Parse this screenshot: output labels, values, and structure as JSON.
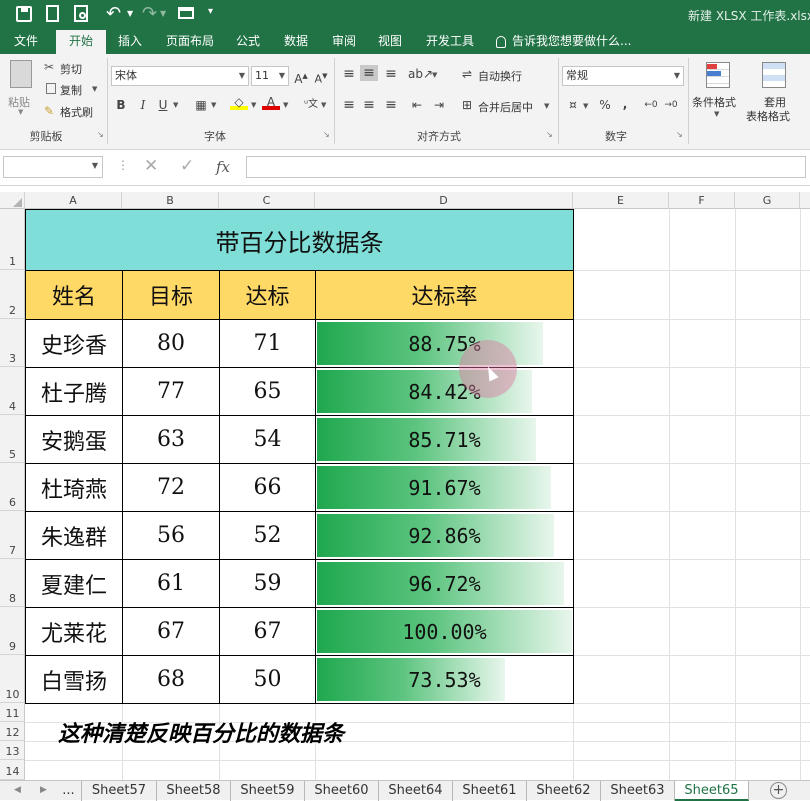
{
  "window": {
    "title": "新建 XLSX 工作表.xlsx",
    "quick_access": [
      "save-icon",
      "new-icon",
      "print-preview-icon",
      "undo-icon",
      "redo-icon",
      "open-icon"
    ]
  },
  "ribbon_tabs": [
    {
      "label": "文件"
    },
    {
      "label": "开始"
    },
    {
      "label": "插入"
    },
    {
      "label": "页面布局"
    },
    {
      "label": "公式"
    },
    {
      "label": "数据"
    },
    {
      "label": "审阅"
    },
    {
      "label": "视图"
    },
    {
      "label": "开发工具"
    },
    {
      "label": "告诉我您想要做什么..."
    }
  ],
  "active_tab": "开始",
  "ribbon": {
    "clipboard": {
      "paste": "粘贴",
      "cut": "剪切",
      "copy": "复制",
      "format_painter": "格式刷",
      "label": "剪贴板"
    },
    "font": {
      "name": "宋体",
      "size": "11",
      "label": "字体"
    },
    "alignment": {
      "wrap": "自动换行",
      "merge": "合并后居中",
      "label": "对齐方式"
    },
    "number": {
      "format": "常规",
      "label": "数字"
    },
    "styles": {
      "conditional": "条件格式",
      "table_format_1": "套用",
      "table_format_2": "表格格式"
    }
  },
  "formula_bar": {
    "name_box": "",
    "formula": "",
    "fx": "fx"
  },
  "columns": [
    "A",
    "B",
    "C",
    "D",
    "E",
    "F",
    "G"
  ],
  "rows": [
    "1",
    "2",
    "3",
    "4",
    "5",
    "6",
    "7",
    "8",
    "9",
    "10",
    "11",
    "12",
    "13",
    "14"
  ],
  "sheet": {
    "title": "带百分比数据条",
    "headers": [
      "姓名",
      "目标",
      "达标",
      "达标率"
    ],
    "records": [
      {
        "name": "史珍香",
        "target": "80",
        "achieved": "71",
        "rate": "88.75%",
        "rate_value": 0.8875
      },
      {
        "name": "杜子腾",
        "target": "77",
        "achieved": "65",
        "rate": "84.42%",
        "rate_value": 0.8442
      },
      {
        "name": "安鹅蛋",
        "target": "63",
        "achieved": "54",
        "rate": "85.71%",
        "rate_value": 0.8571
      },
      {
        "name": "杜琦燕",
        "target": "72",
        "achieved": "66",
        "rate": "91.67%",
        "rate_value": 0.9167
      },
      {
        "name": "朱逸群",
        "target": "56",
        "achieved": "52",
        "rate": "92.86%",
        "rate_value": 0.9286
      },
      {
        "name": "夏建仁",
        "target": "61",
        "achieved": "59",
        "rate": "96.72%",
        "rate_value": 0.9672
      },
      {
        "name": "尤莱花",
        "target": "67",
        "achieved": "67",
        "rate": "100.00%",
        "rate_value": 1.0
      },
      {
        "name": "白雪扬",
        "target": "68",
        "achieved": "50",
        "rate": "73.53%",
        "rate_value": 0.7353
      }
    ]
  },
  "caption": "这种清楚反映百分比的数据条",
  "sheet_tabs": [
    "...",
    "Sheet57",
    "Sheet58",
    "Sheet59",
    "Sheet60",
    "Sheet64",
    "Sheet61",
    "Sheet62",
    "Sheet63",
    "Sheet65"
  ],
  "active_sheet": "Sheet65",
  "colors": {
    "excel_green": "#217346",
    "title_fill": "#7fded7",
    "header_fill": "#ffd966",
    "bar": "#1fa84e"
  }
}
